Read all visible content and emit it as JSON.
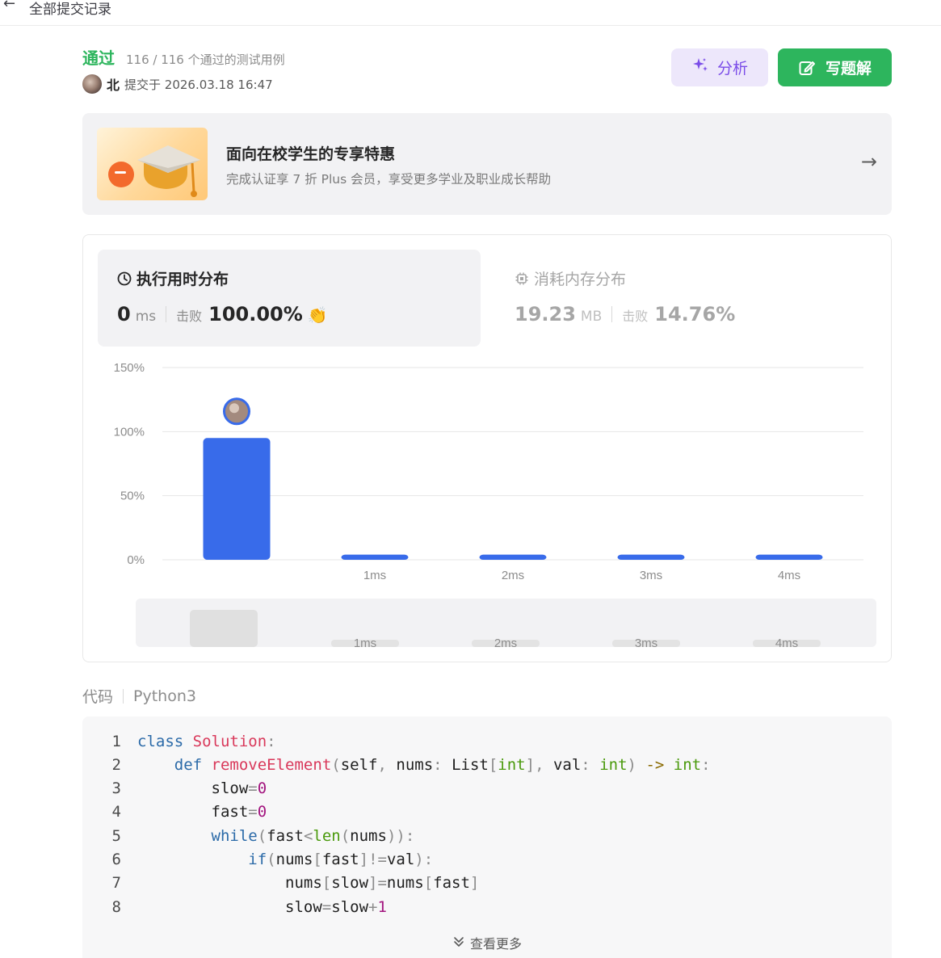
{
  "topbar": {
    "back_icon": "arrow-left-icon",
    "title": "全部提交记录"
  },
  "submission": {
    "status": "通过",
    "cases": "116 / 116 个通过的测试用例",
    "username": "北",
    "submitted_at": "提交于 2026.03.18 16:47"
  },
  "actions": {
    "analyze_label": "分析",
    "write_label": "写题解"
  },
  "promo": {
    "title": "面向在校学生的专享特惠",
    "subtitle": "完成认证享 7 折 Plus 会员，享受更多学业及职业成长帮助"
  },
  "runtime": {
    "title": "执行用时分布",
    "value": "0",
    "unit": "ms",
    "beat_label": "击败",
    "beat_value": "100.00%"
  },
  "memory": {
    "title": "消耗内存分布",
    "value": "19.23",
    "unit": "MB",
    "beat_label": "击败",
    "beat_value": "14.76%"
  },
  "chart_data": {
    "type": "bar",
    "categories": [
      "0ms",
      "1ms",
      "2ms",
      "3ms",
      "4ms"
    ],
    "tick_labels": [
      "",
      "1ms",
      "2ms",
      "3ms",
      "4ms"
    ],
    "values": [
      95,
      4,
      4,
      4,
      4
    ],
    "y_ticks": [
      "0%",
      "50%",
      "100%",
      "150%"
    ],
    "ylim": [
      0,
      150
    ],
    "bar_color": "#386bea",
    "grid": true,
    "marker_on_category": 0,
    "overview": {
      "tick_labels": [
        "1ms",
        "2ms",
        "3ms",
        "4ms"
      ],
      "selected_category": 0
    }
  },
  "code": {
    "label": "代码",
    "language": "Python3",
    "lines": [
      "class Solution:",
      "    def removeElement(self, nums: List[int], val: int) -> int:",
      "        slow=0",
      "        fast=0",
      "        while(fast<len(nums)):",
      "            if(nums[fast]!=val):",
      "                nums[slow]=nums[fast]",
      "                slow=slow+1"
    ],
    "line_numbers": [
      "1",
      "2",
      "3",
      "4",
      "5",
      "6",
      "7",
      "8"
    ],
    "more_label": "查看更多"
  }
}
